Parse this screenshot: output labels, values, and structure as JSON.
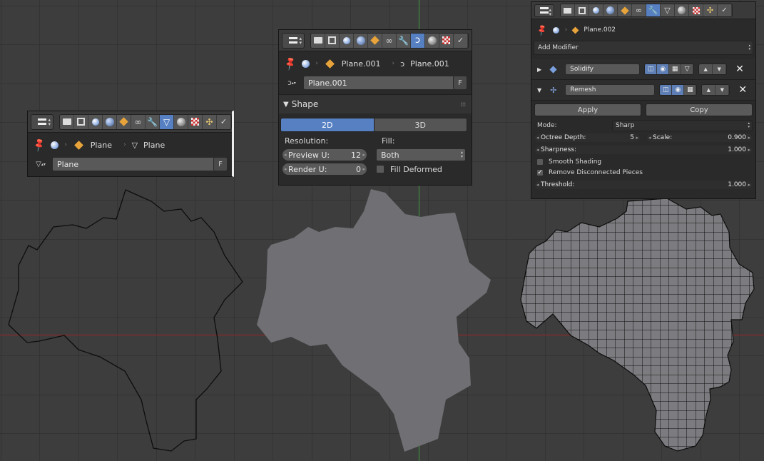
{
  "panel_left": {
    "crumb_object": "Plane",
    "crumb_data": "Plane",
    "datablock_name": "Plane",
    "fake_user": "F"
  },
  "panel_mid": {
    "crumb_object": "Plane.001",
    "crumb_data": "Plane.001",
    "datablock_name": "Plane.001",
    "fake_user": "F",
    "shape_title": "Shape",
    "tab_2d": "2D",
    "tab_3d": "3D",
    "resolution_label": "Resolution:",
    "fill_label": "Fill:",
    "preview_u_label": "Preview U:",
    "preview_u_value": "12",
    "render_u_label": "Render U:",
    "render_u_value": "0",
    "fill_value": "Both",
    "fill_deformed_label": "Fill Deformed"
  },
  "panel_right": {
    "crumb_object": "Plane.002",
    "add_modifier": "Add Modifier",
    "mod1_name": "Solidify",
    "mod2_name": "Remesh",
    "apply_label": "Apply",
    "copy_label": "Copy",
    "mode_label": "Mode:",
    "mode_value": "Sharp",
    "octree_label": "Octree Depth:",
    "octree_value": "5",
    "scale_label": "Scale:",
    "scale_value": "0.900",
    "sharpness_label": "Sharpness:",
    "sharpness_value": "1.000",
    "smooth_shading_label": "Smooth Shading",
    "remove_disconnected_label": "Remove Disconnected Pieces",
    "threshold_label": "Threshold:",
    "threshold_value": "1.000"
  },
  "colors": {
    "viewport_bg": "#3d3d3d",
    "grid": "#2c2c2c",
    "x_axis": "#8b2a2a",
    "y_axis": "#3f8a3f",
    "fill_shape": "#6f6f74",
    "accent": "#5680c2"
  }
}
